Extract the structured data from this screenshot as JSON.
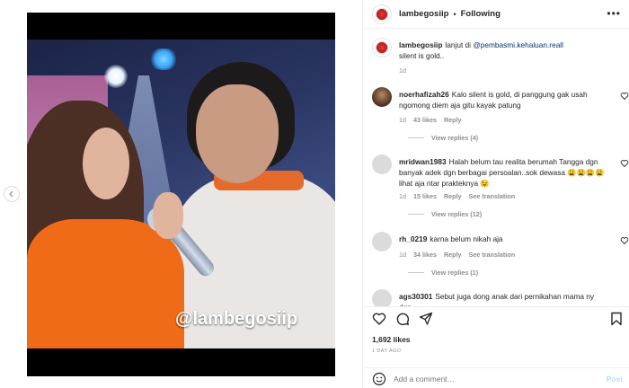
{
  "media": {
    "watermark": "@lambegosiip",
    "carousel_dots": 2,
    "carousel_active": 0
  },
  "header": {
    "username": "lambegosiip",
    "separator": "•",
    "follow_status": "Following",
    "more_icon": "more-icon"
  },
  "caption": {
    "username": "lambegosiip",
    "text_prefix": "lanjut di ",
    "mention": "@pembasmi.kehaluan.reall",
    "text_line2": "silent is gold..",
    "time": "1d"
  },
  "comments": [
    {
      "username": "noerhafizah26",
      "text": "Kalo silent is gold, di panggung gak usah ngomong diem aja gitu kayak patung",
      "time": "1d",
      "likes": "43 likes",
      "reply": "Reply",
      "see_translation": "",
      "view_replies": "View replies (4)"
    },
    {
      "username": "mridwan1983",
      "text": "Halah belum tau realita berumah Tangga dgn banyak adek dgn berbagai persoalan..sok dewasa 😩😩😩😩 lihat aja ntar prakteknya 😉",
      "time": "1d",
      "likes": "15 likes",
      "reply": "Reply",
      "see_translation": "See translation",
      "view_replies": "View replies (12)"
    },
    {
      "username": "rh_0219",
      "text": "karna belum nikah aja",
      "time": "1d",
      "likes": "34 likes",
      "reply": "Reply",
      "see_translation": "See translation",
      "view_replies": "View replies (1)"
    },
    {
      "username": "ags30301",
      "text": "Sebut juga dong anak dari pernikahan mama ny dgn",
      "time": "",
      "likes": "",
      "reply": "",
      "see_translation": "",
      "view_replies": ""
    }
  ],
  "actions": {
    "likes": "1,692 likes",
    "date": "1 DAY AGO"
  },
  "add_comment": {
    "placeholder": "Add a comment…",
    "post_label": "Post"
  },
  "colors": {
    "text": "#262626",
    "muted": "#8e8e8e",
    "link": "#00376b",
    "post_disabled": "#b2dffc"
  }
}
